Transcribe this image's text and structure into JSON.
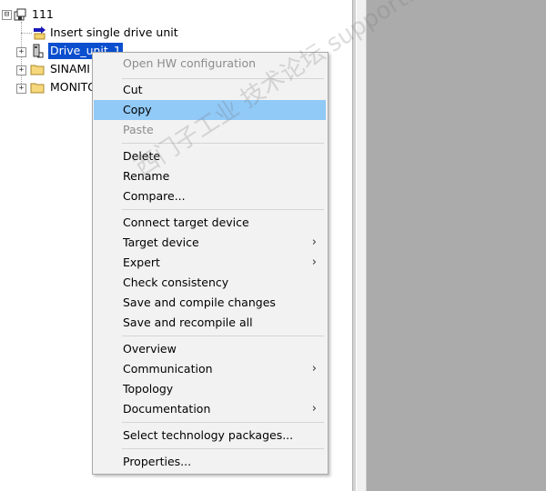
{
  "tree": {
    "root": {
      "label": "111",
      "expander": "⊟"
    },
    "items": [
      {
        "label": "Insert single drive unit"
      },
      {
        "label": "Drive_unit_1",
        "expander": "+"
      },
      {
        "label": "SINAMI",
        "expander": "+"
      },
      {
        "label": "MONITO",
        "expander": "+"
      }
    ]
  },
  "context_menu": {
    "items": [
      {
        "label": "Open HW configuration",
        "disabled": true
      },
      {
        "label": "Cut"
      },
      {
        "label": "Copy",
        "highlighted": true
      },
      {
        "label": "Paste",
        "disabled": true
      },
      {
        "label": "Delete"
      },
      {
        "label": "Rename"
      },
      {
        "label": "Compare..."
      },
      {
        "label": "Connect target device"
      },
      {
        "label": "Target device",
        "submenu_arrow": "›"
      },
      {
        "label": "Expert",
        "submenu_arrow": "›"
      },
      {
        "label": "Check consistency"
      },
      {
        "label": "Save and compile changes"
      },
      {
        "label": "Save and recompile all"
      },
      {
        "label": "Overview"
      },
      {
        "label": "Communication",
        "submenu_arrow": "›"
      },
      {
        "label": "Topology"
      },
      {
        "label": "Documentation",
        "submenu_arrow": "›"
      },
      {
        "label": "Select technology packages..."
      },
      {
        "label": "Properties..."
      }
    ]
  },
  "watermark": {
    "text": "西门子工业 技术论坛 support.industry.siemens.com/cs"
  },
  "colors": {
    "selection": "#0b4fcf",
    "menu_highlight": "#91c9f7",
    "menu_background": "#f2f2f2",
    "right_pane": "#ababab"
  }
}
